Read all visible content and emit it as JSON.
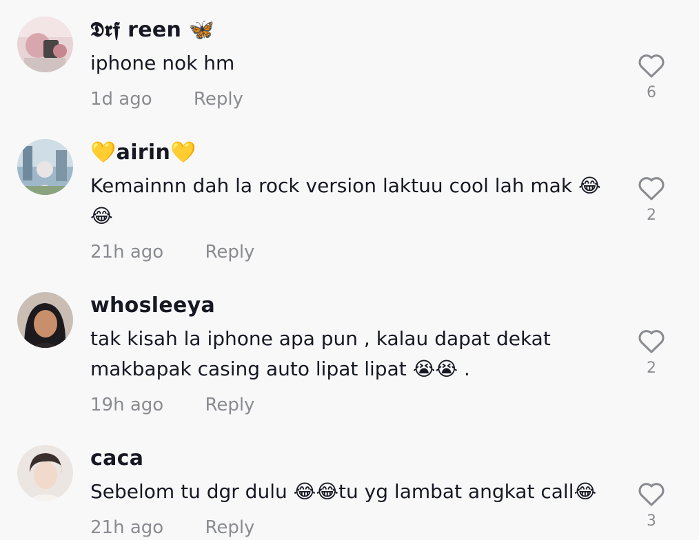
{
  "comments": [
    {
      "username": "𝕯𝖗𝖋 reen 🦋",
      "text": "iphone nok hm",
      "time": "1d ago",
      "reply_label": "Reply",
      "likes": "6",
      "avatar_icon": "pink-room-photo-avatar"
    },
    {
      "username": "💛airin💛",
      "text": "Kemainnn dah la rock version laktuu cool lah mak 😂 😂",
      "time": "21h ago",
      "reply_label": "Reply",
      "likes": "2",
      "avatar_icon": "city-hijab-photo-avatar"
    },
    {
      "username": "whosleeya",
      "text": "tak kisah la iphone apa pun , kalau dapat dekat makbapak casing auto lipat lipat 😭😭 .",
      "time": "19h ago",
      "reply_label": "Reply",
      "likes": "2",
      "avatar_icon": "selfie-photo-avatar"
    },
    {
      "username": "caca",
      "text": "Sebelom tu dgr dulu 😂😂tu yg lambat angkat call😂",
      "time": "21h ago",
      "reply_label": "Reply",
      "likes": "3",
      "avatar_icon": "portrait-photo-avatar"
    }
  ],
  "colors": {
    "background": "#f8f8f8",
    "text": "#161823",
    "muted": "#8a8b91"
  }
}
